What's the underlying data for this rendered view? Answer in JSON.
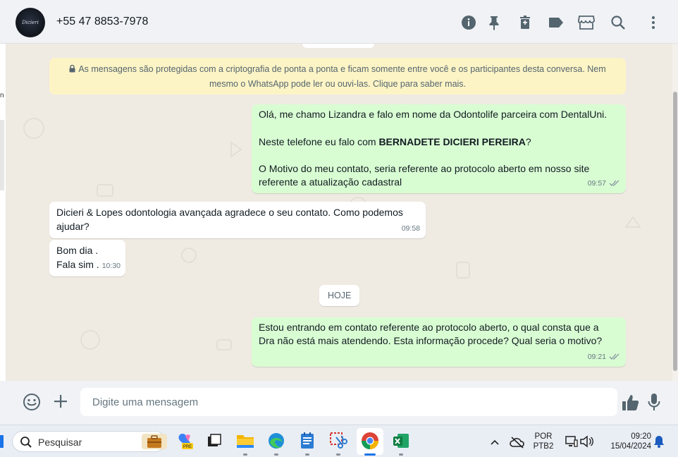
{
  "header": {
    "contact_name": "+55 47 8853-7978",
    "avatar_logo_text": "Dicieri",
    "icons": [
      "info-icon",
      "pin-icon",
      "delete-icon",
      "label-icon",
      "store-icon",
      "search-icon",
      "more-icon"
    ]
  },
  "chat": {
    "encryption_notice": "As mensagens são protegidas com a criptografia de ponta a ponta e ficam somente entre você e os participantes desta conversa. Nem mesmo o WhatsApp pode ler ou ouvi-las. Clique para saber mais.",
    "messages": [
      {
        "direction": "out",
        "line1": "Olá, me chamo Lizandra e falo em nome da Odontolife parceira com DentalUni.",
        "line2_prefix": "Neste telefone eu falo com ",
        "line2_bold": "BERNADETE DICIERI PEREIRA",
        "line2_suffix": "?",
        "line3a": "O Motivo do meu contato, seria referente ao protocolo aberto em nosso site",
        "line3b": "referente a atualização cadastral",
        "time": "09:57",
        "status": "read"
      },
      {
        "direction": "in",
        "line1": "Dicieri & Lopes odontologia avançada agradece o seu contato. Como podemos",
        "line2": "ajudar?",
        "time": "09:58"
      },
      {
        "direction": "in",
        "line1": "Bom dia .",
        "line2": "Fala sim .",
        "time": "10:30"
      },
      {
        "direction": "out",
        "line1": "Estou entrando em contato referente ao protocolo aberto, o qual consta que a",
        "line2": "Dra não está mais atendendo. Esta informação procede? Qual seria o motivo?",
        "time": "09:21",
        "status": "read"
      }
    ],
    "day_separator": "HOJE"
  },
  "composer": {
    "placeholder": "Digite uma mensagem"
  },
  "taskbar": {
    "search_label": "Pesquisar",
    "language_line1": "POR",
    "language_line2": "PTB2",
    "time": "09:20",
    "date": "15/04/2024"
  },
  "colors": {
    "outgoing_bubble": "#d9fdd3",
    "incoming_bubble": "#ffffff",
    "chat_background": "#efeae2",
    "encryption_banner": "#fdf4c5"
  }
}
